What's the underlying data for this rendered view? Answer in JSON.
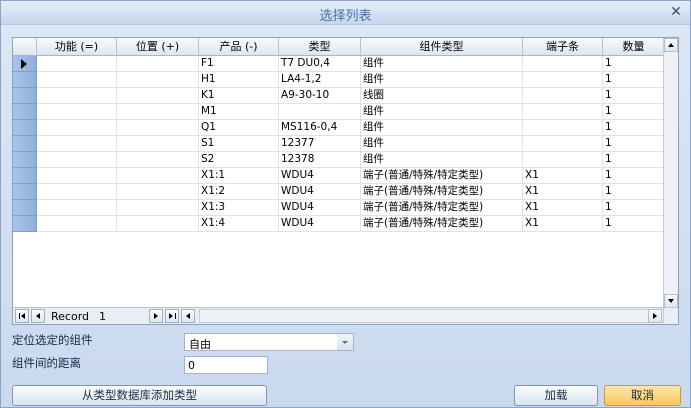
{
  "window": {
    "title": "选择列表"
  },
  "grid": {
    "columns": [
      {
        "label": "功能 (=)",
        "w": 80
      },
      {
        "label": "位置 (+)",
        "w": 82
      },
      {
        "label": "产品 (-)",
        "w": 80
      },
      {
        "label": "类型",
        "w": 82
      },
      {
        "label": "组件类型",
        "w": 162
      },
      {
        "label": "端子条",
        "w": 80
      },
      {
        "label": "数量",
        "w": 62
      }
    ],
    "rows": [
      [
        "",
        "",
        "F1",
        "T7 DU0,4",
        "组件",
        "",
        "1"
      ],
      [
        "",
        "",
        "H1",
        "LA4-1,2",
        "组件",
        "",
        "1"
      ],
      [
        "",
        "",
        "K1",
        "A9-30-10",
        "线圈",
        "",
        "1"
      ],
      [
        "",
        "",
        "M1",
        "",
        "组件",
        "",
        "1"
      ],
      [
        "",
        "",
        "Q1",
        "MS116-0,4",
        "组件",
        "",
        "1"
      ],
      [
        "",
        "",
        "S1",
        "12377",
        "组件",
        "",
        "1"
      ],
      [
        "",
        "",
        "S2",
        "12378",
        "组件",
        "",
        "1"
      ],
      [
        "",
        "",
        "X1:1",
        "WDU4",
        "端子(普通/特殊/特定类型)",
        "X1",
        "1"
      ],
      [
        "",
        "",
        "X1:2",
        "WDU4",
        "端子(普通/特殊/特定类型)",
        "X1",
        "1"
      ],
      [
        "",
        "",
        "X1:3",
        "WDU4",
        "端子(普通/特殊/特定类型)",
        "X1",
        "1"
      ],
      [
        "",
        "",
        "X1:4",
        "WDU4",
        "端子(普通/特殊/特定类型)",
        "X1",
        "1"
      ]
    ],
    "navigator": {
      "record_label": "Record",
      "record_value": "1"
    }
  },
  "form": {
    "locate_label": "定位选定的组件",
    "locate_value": "自由",
    "distance_label": "组件间的距离",
    "distance_value": "0"
  },
  "buttons": {
    "add_from_db": "从类型数据库添加类型",
    "load": "加载",
    "cancel": "取消"
  }
}
